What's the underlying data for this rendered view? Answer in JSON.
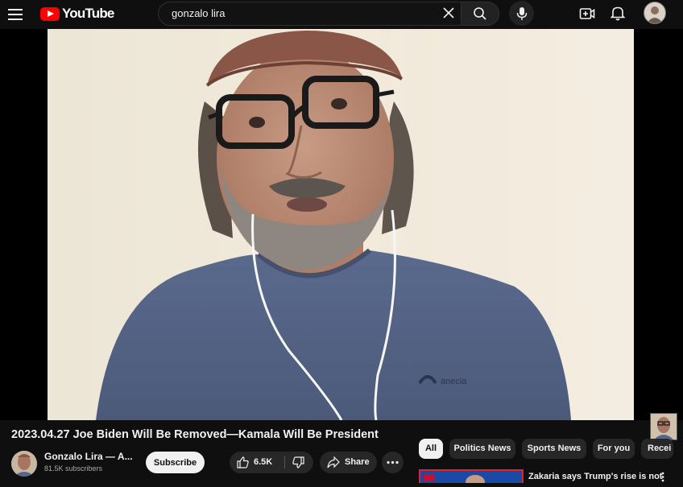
{
  "header": {
    "logo_text": "YouTube",
    "search_query": "gonzalo lira"
  },
  "video": {
    "title": "2023.04.27 Joe Biden Will Be Removed—Kamala Will Be President",
    "shirt_logo_text": "anecia"
  },
  "channel": {
    "name": "Gonzalo Lira — A...",
    "subscribers": "81.5K subscribers",
    "subscribe_label": "Subscribe"
  },
  "actions": {
    "like_count": "6.5K",
    "share_label": "Share"
  },
  "chips": [
    "All",
    "Politics News",
    "Sports News",
    "For you",
    "Recei"
  ],
  "recommendation": {
    "title": "Zakaria says Trump's rise is not"
  },
  "colors": {
    "background": "#0f0f0f",
    "brand_red": "#ff0000",
    "chip_bg": "#272727",
    "text": "#f1f1f1"
  },
  "icons": [
    "menu-icon",
    "youtube-logo-icon",
    "clear-icon",
    "search-icon",
    "mic-icon",
    "create-icon",
    "bell-icon",
    "thumbs-up-icon",
    "thumbs-down-icon",
    "share-icon",
    "more-icon"
  ]
}
